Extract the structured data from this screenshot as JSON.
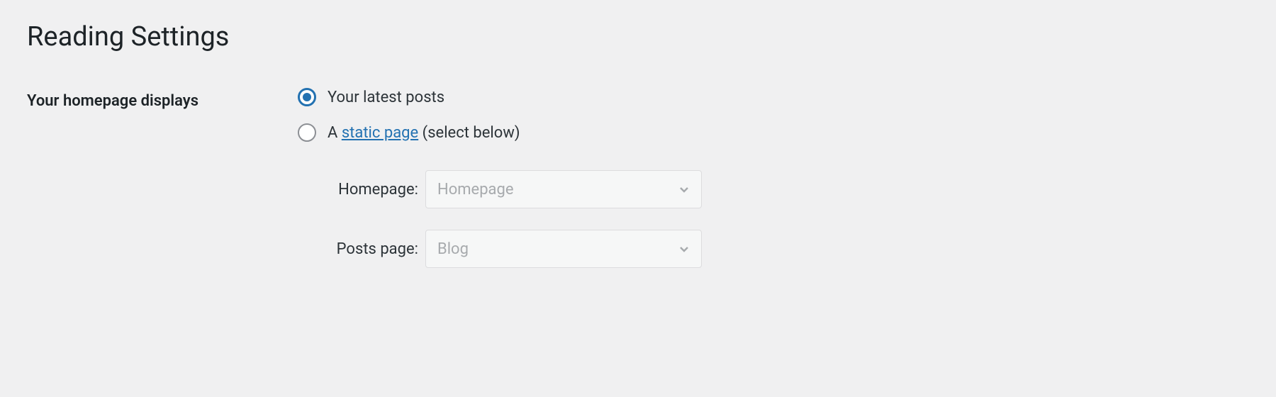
{
  "page_title": "Reading Settings",
  "section": {
    "label": "Your homepage displays",
    "options": {
      "latest_posts": {
        "label": "Your latest posts",
        "checked": true
      },
      "static_page": {
        "prefix": "A ",
        "link_text": "static page",
        "suffix": " (select below)",
        "checked": false
      }
    },
    "selects": {
      "homepage": {
        "label": "Homepage:",
        "value": "Homepage"
      },
      "posts_page": {
        "label": "Posts page:",
        "value": "Blog"
      }
    }
  }
}
